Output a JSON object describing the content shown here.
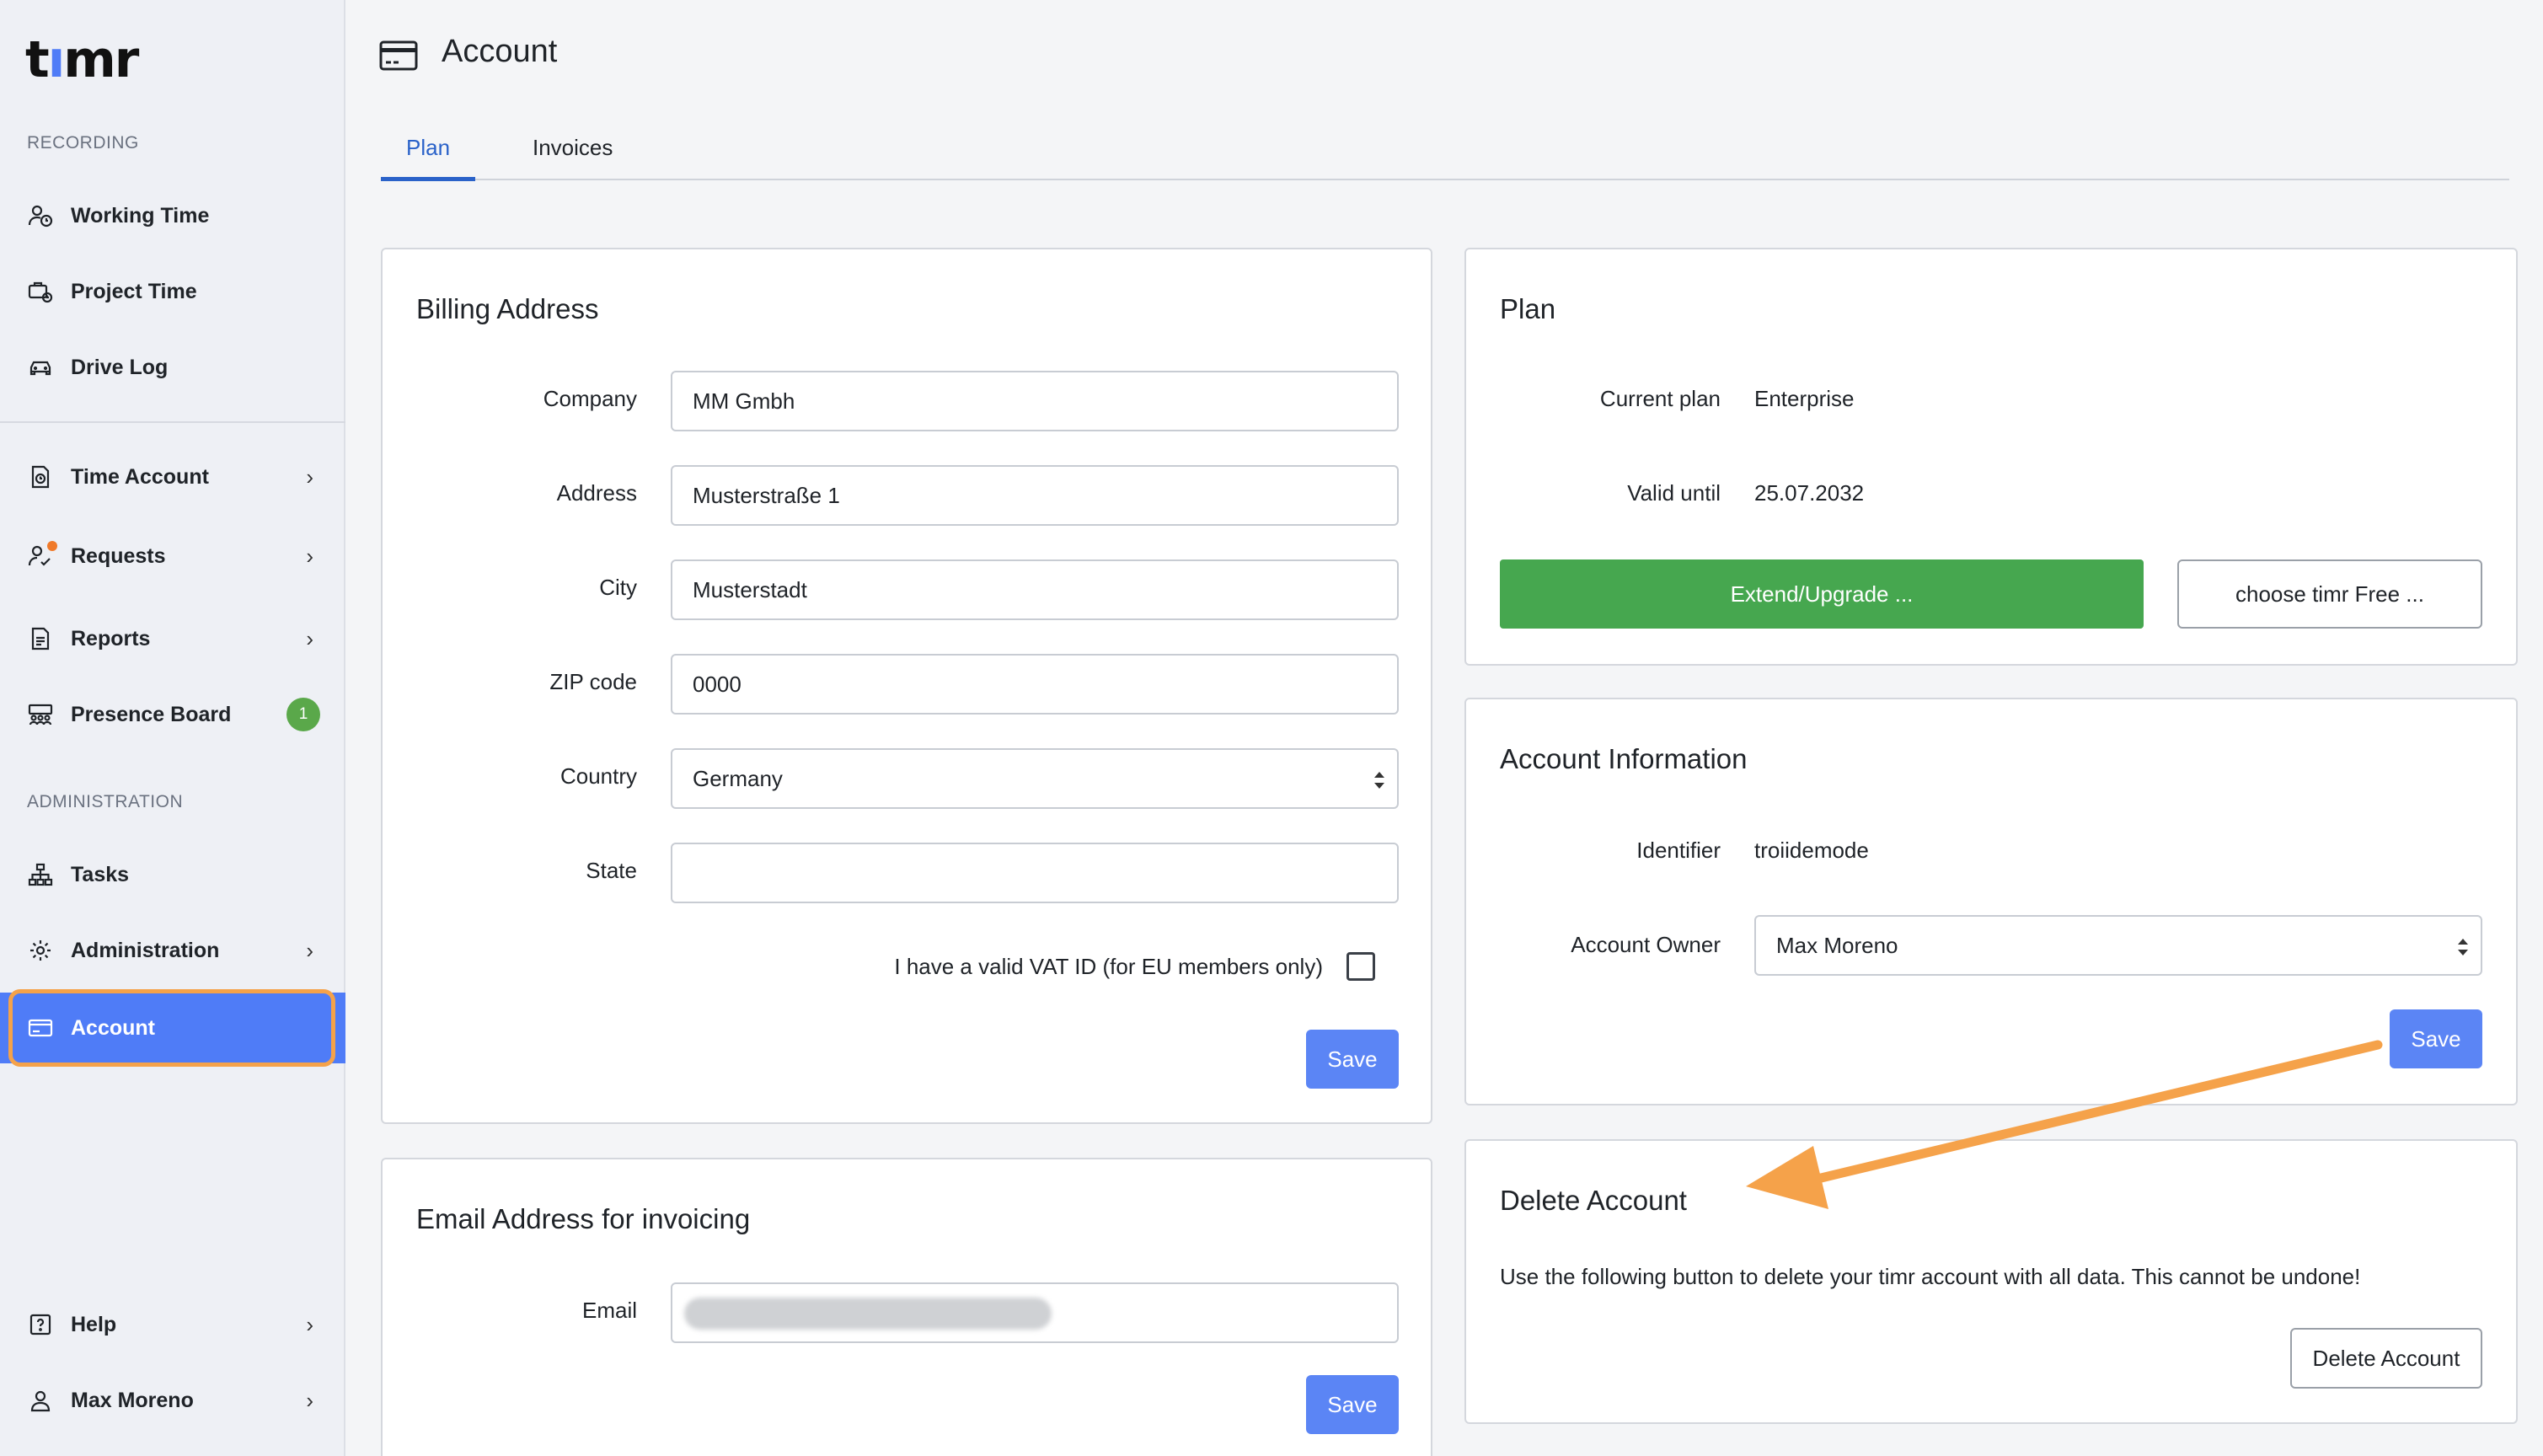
{
  "app": {
    "logo_text_1": "t",
    "logo_text_2": "ı",
    "logo_text_3": "mr"
  },
  "colors": {
    "accent": "#4f7cf7",
    "highlight": "#f5a24a",
    "green": "#46a74f",
    "badge": "#5aa84a"
  },
  "sidebar": {
    "recording_label": "RECORDING",
    "administration_label": "ADMINISTRATION",
    "items": [
      {
        "label": "Working Time",
        "icon": "user-clock-icon"
      },
      {
        "label": "Project Time",
        "icon": "briefcase-clock-icon"
      },
      {
        "label": "Drive Log",
        "icon": "car-icon"
      },
      {
        "label": "Time Account",
        "icon": "document-clock-icon"
      },
      {
        "label": "Requests",
        "icon": "user-check-icon"
      },
      {
        "label": "Reports",
        "icon": "report-icon"
      },
      {
        "label": "Presence Board",
        "icon": "users-board-icon",
        "badge": "1"
      },
      {
        "label": "Tasks",
        "icon": "hierarchy-icon"
      },
      {
        "label": "Administration",
        "icon": "gear-icon"
      },
      {
        "label": "Account",
        "icon": "credit-card-icon"
      },
      {
        "label": "Help",
        "icon": "help-icon"
      },
      {
        "label": "Max Moreno",
        "icon": "user-icon"
      }
    ],
    "chevron": "›"
  },
  "page": {
    "title": "Account",
    "tabs": [
      {
        "label": "Plan"
      },
      {
        "label": "Invoices"
      }
    ]
  },
  "billing": {
    "title": "Billing Address",
    "company_label": "Company",
    "company_value": "MM Gmbh",
    "address_label": "Address",
    "address_value": "Musterstraße 1",
    "city_label": "City",
    "city_value": "Musterstadt",
    "zip_label": "ZIP code",
    "zip_value": "0000",
    "country_label": "Country",
    "country_value": "Germany",
    "state_label": "State",
    "state_value": "",
    "vat_label": "I have a valid VAT ID (for EU members only)",
    "save_label": "Save"
  },
  "invoice_email": {
    "title": "Email Address for invoicing",
    "email_label": "Email",
    "save_label": "Save"
  },
  "plan": {
    "title": "Plan",
    "current_plan_label": "Current plan",
    "current_plan_value": "Enterprise",
    "valid_until_label": "Valid until",
    "valid_until_value": "25.07.2032",
    "extend_label": "Extend/Upgrade ...",
    "free_label": "choose timr Free ..."
  },
  "account_info": {
    "title": "Account Information",
    "identifier_label": "Identifier",
    "identifier_value": "troiidemode",
    "owner_label": "Account Owner",
    "owner_value": "Max Moreno",
    "save_label": "Save"
  },
  "delete_account": {
    "title": "Delete Account",
    "description": "Use the following button to delete your timr account with all data. This cannot be undone!",
    "button_label": "Delete Account"
  }
}
